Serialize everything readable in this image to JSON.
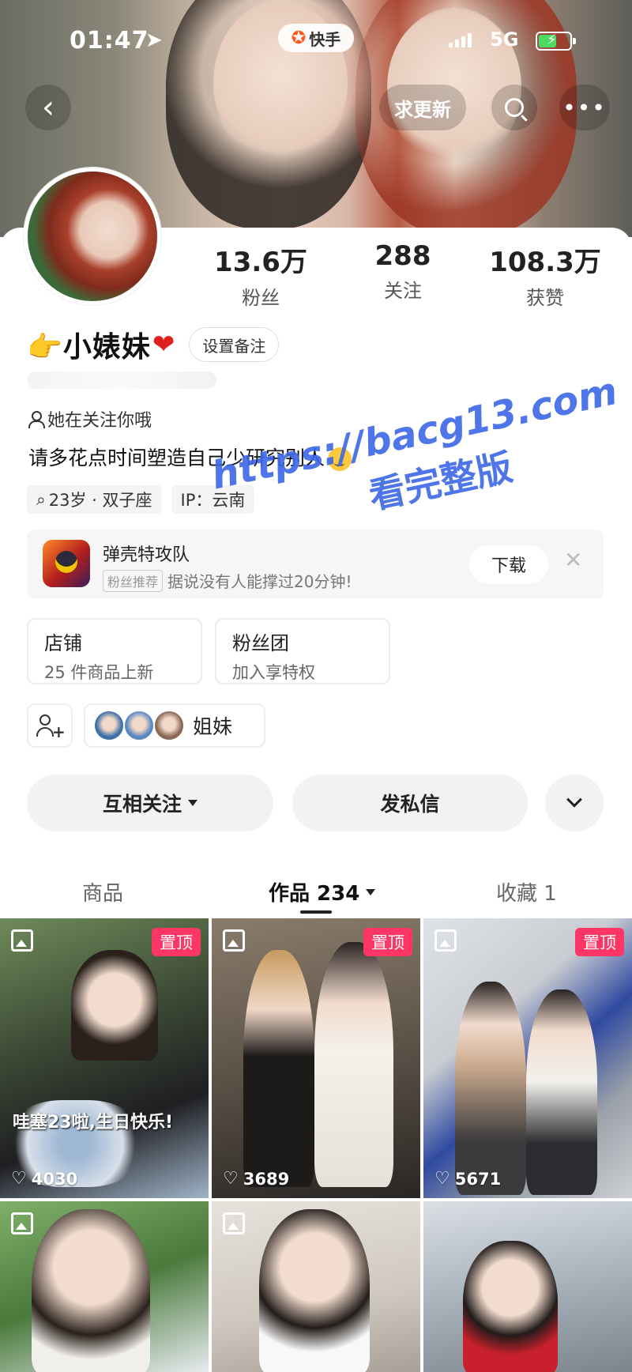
{
  "status_bar": {
    "time": "01:47",
    "network": "5G"
  },
  "app": {
    "name": "快手"
  },
  "nav": {
    "update_label": "求更新"
  },
  "profile": {
    "name": "👉小婊妹",
    "remark_label": "设置备注",
    "follows_you": "她在关注你哦",
    "bio": "请多花点时间塑造自己少研究别人",
    "tags": [
      "23岁 · 双子座",
      "IP：云南"
    ]
  },
  "stats": [
    {
      "value": "13.6万",
      "label": "粉丝"
    },
    {
      "value": "288",
      "label": "关注"
    },
    {
      "value": "108.3万",
      "label": "获赞"
    }
  ],
  "ad": {
    "title": "弹壳特攻队",
    "badge": "粉丝推荐",
    "subtitle": "据说没有人能撑过20分钟!",
    "download_label": "下载"
  },
  "entries": [
    {
      "title": "店铺",
      "subtitle": "25 件商品上新"
    },
    {
      "title": "粉丝团",
      "subtitle": "加入享特权"
    }
  ],
  "group": {
    "label": "姐妹"
  },
  "actions": {
    "follow_label": "互相关注",
    "message_label": "发私信"
  },
  "tabs": {
    "goods": "商品",
    "works": "作品 234",
    "favorites": "收藏 1"
  },
  "grid": [
    {
      "likes": "4030",
      "pinned": "置顶",
      "caption": "哇塞23啦,生日快乐!"
    },
    {
      "likes": "3689",
      "pinned": "置顶"
    },
    {
      "likes": "5671",
      "pinned": "置顶"
    }
  ],
  "watermark": {
    "url": "https://bacg13.com",
    "text": "看完整版"
  },
  "colors": {
    "pin": "#fe3666",
    "watermark": "#3c68e6",
    "brand": "#ff5a1f"
  }
}
